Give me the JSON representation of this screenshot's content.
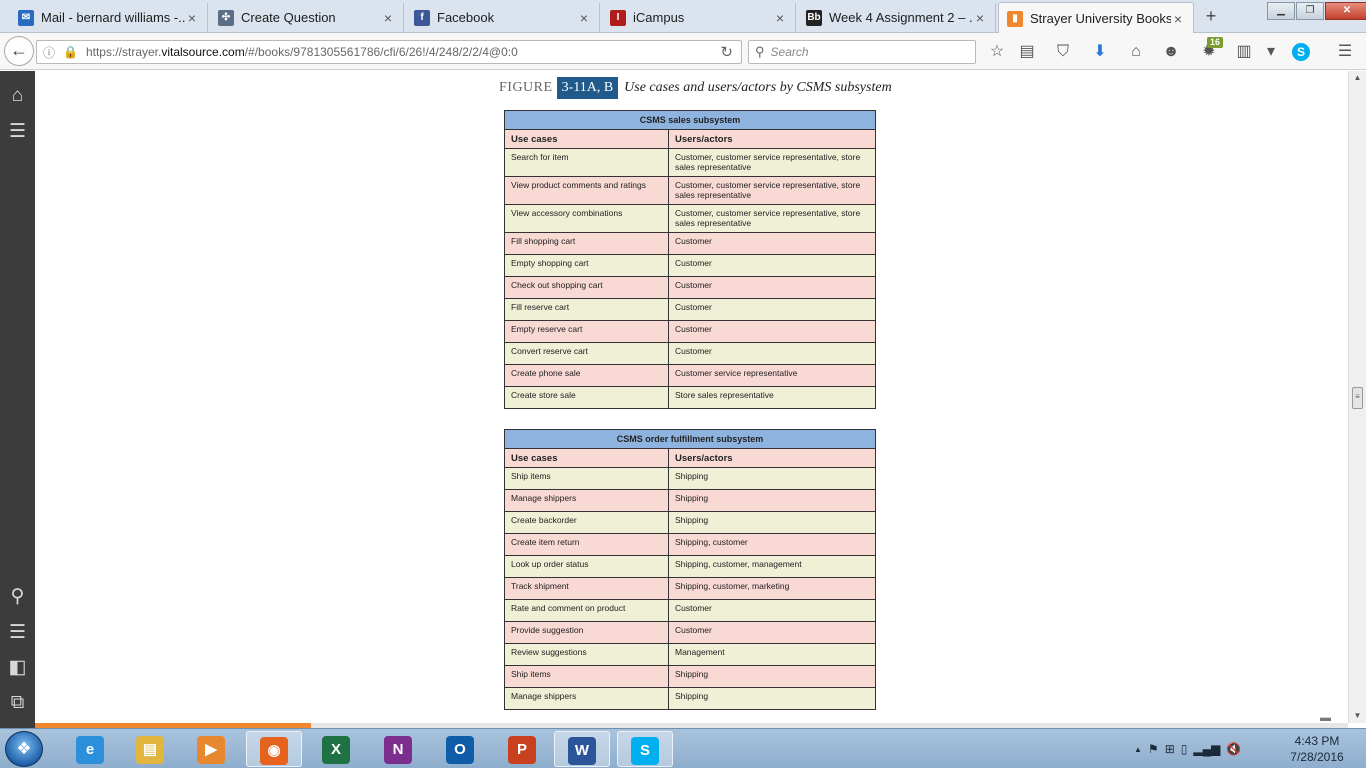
{
  "browser": {
    "tabs": [
      {
        "label": "Mail - bernard williams -...",
        "icon": "mail-icon",
        "icon_glyph": "✉",
        "icon_color": "#2a6ac0"
      },
      {
        "label": "Create Question",
        "icon": "network-icon",
        "icon_glyph": "✣",
        "icon_color": "#5a6f85"
      },
      {
        "label": "Facebook",
        "icon": "facebook-icon",
        "icon_glyph": "f",
        "icon_color": "#3b5998"
      },
      {
        "label": "iCampus",
        "icon": "icampus-icon",
        "icon_glyph": "I",
        "icon_color": "#b11d1d"
      },
      {
        "label": "Week 4 Assignment 2 – ...",
        "icon": "blackboard-icon",
        "icon_glyph": "Bb",
        "icon_color": "#222222"
      },
      {
        "label": "Strayer University Books...",
        "icon": "vitalsource-icon",
        "icon_glyph": "▮",
        "icon_color": "#f0862d"
      }
    ],
    "tab_close_glyph": "×",
    "new_tab_glyph": "+",
    "window_controls": {
      "minimize": "▁",
      "maximize": "❐",
      "close": "✕"
    },
    "url_prefix": "https://strayer.",
    "url_domain": "vitalsource.com",
    "url_path": "/#/books/9781305561786/cfi/6/26!/4/248/2/2/4@0:0",
    "search_placeholder": "Search",
    "extension_badge": "16",
    "back_glyph": "←",
    "info_glyph": "ⓘ",
    "lock_glyph": "🔒",
    "reload_glyph": "↻",
    "search_glyph": "⚲",
    "toolbar_icons": [
      {
        "name": "bookmark-star-icon",
        "glyph": "☆"
      },
      {
        "name": "reading-list-icon",
        "glyph": "▤"
      },
      {
        "name": "pocket-icon",
        "glyph": "⛉"
      },
      {
        "name": "downloads-icon",
        "glyph": "⬇"
      },
      {
        "name": "home-icon",
        "glyph": "⌂"
      },
      {
        "name": "chat-icon",
        "glyph": "☻"
      },
      {
        "name": "extension-icon",
        "glyph": "✹"
      },
      {
        "name": "clipboard-icon",
        "glyph": "▥"
      },
      {
        "name": "dropdown-icon",
        "glyph": "▾"
      },
      {
        "name": "skype-icon",
        "glyph": "S"
      },
      {
        "name": "menu-icon",
        "glyph": "☰"
      }
    ]
  },
  "sidebar": {
    "top_icons": [
      {
        "name": "home-icon",
        "glyph": "⌂"
      },
      {
        "name": "menu-icon",
        "glyph": "☰"
      }
    ],
    "bottom_icons": [
      {
        "name": "search-icon",
        "glyph": "⚲"
      },
      {
        "name": "toc-icon",
        "glyph": "☰"
      },
      {
        "name": "bookmark-panel-icon",
        "glyph": "◧"
      },
      {
        "name": "copy-icon",
        "glyph": "⧉"
      }
    ]
  },
  "figure": {
    "label": "FIGURE",
    "number": "3-11A, B",
    "title": "Use cases and users/actors by CSMS subsystem"
  },
  "tables": [
    {
      "title": "CSMS sales subsystem",
      "col1": "Use cases",
      "col2": "Users/actors",
      "rows": [
        {
          "use_case": "Search for item",
          "actors": "Customer, customer service representative, store sales representative"
        },
        {
          "use_case": "View product comments and ratings",
          "actors": "Customer, customer service representative, store sales representative"
        },
        {
          "use_case": "View accessory combinations",
          "actors": "Customer, customer service representative, store sales representative"
        },
        {
          "use_case": "Fill shopping cart",
          "actors": "Customer"
        },
        {
          "use_case": "Empty shopping cart",
          "actors": "Customer"
        },
        {
          "use_case": "Check out shopping cart",
          "actors": "Customer"
        },
        {
          "use_case": "Fill reserve cart",
          "actors": "Customer"
        },
        {
          "use_case": "Empty reserve cart",
          "actors": "Customer"
        },
        {
          "use_case": "Convert reserve cart",
          "actors": "Customer"
        },
        {
          "use_case": "Create phone sale",
          "actors": "Customer service representative"
        },
        {
          "use_case": "Create store sale",
          "actors": "Store sales representative"
        }
      ]
    },
    {
      "title": "CSMS order fulfillment subsystem",
      "col1": "Use cases",
      "col2": "Users/actors",
      "rows": [
        {
          "use_case": "Ship items",
          "actors": "Shipping"
        },
        {
          "use_case": "Manage shippers",
          "actors": "Shipping"
        },
        {
          "use_case": "Create backorder",
          "actors": "Shipping"
        },
        {
          "use_case": "Create item return",
          "actors": "Shipping, customer"
        },
        {
          "use_case": "Look up order status",
          "actors": "Shipping, customer, management"
        },
        {
          "use_case": "Track shipment",
          "actors": "Shipping, customer, marketing"
        },
        {
          "use_case": "Rate and comment on product",
          "actors": "Customer"
        },
        {
          "use_case": "Provide suggestion",
          "actors": "Customer"
        },
        {
          "use_case": "Review suggestions",
          "actors": "Management"
        },
        {
          "use_case": "Ship items",
          "actors": "Shipping"
        },
        {
          "use_case": "Manage shippers",
          "actors": "Shipping"
        }
      ]
    }
  ],
  "reading_progress": 0.21,
  "scrollbar": {
    "up": "▲",
    "down": "▼",
    "grip": "≡"
  },
  "page_menu_glyph": "▬",
  "taskbar": {
    "start_glyph": "❖",
    "apps": [
      {
        "name": "internet-explorer-icon",
        "glyph": "e",
        "color": "#2b8fdc",
        "open": false
      },
      {
        "name": "file-explorer-icon",
        "glyph": "▤",
        "color": "#e2b53f",
        "open": false
      },
      {
        "name": "media-player-icon",
        "glyph": "▶",
        "color": "#e8882e",
        "open": false
      },
      {
        "name": "firefox-icon",
        "glyph": "◉",
        "color": "#e5631f",
        "open": true
      },
      {
        "name": "excel-icon",
        "glyph": "X",
        "color": "#1f7244",
        "open": false
      },
      {
        "name": "onenote-icon",
        "glyph": "N",
        "color": "#7b2e8d",
        "open": false
      },
      {
        "name": "outlook-icon",
        "glyph": "O",
        "color": "#0f5da8",
        "open": false
      },
      {
        "name": "powerpoint-icon",
        "glyph": "P",
        "color": "#c9401f",
        "open": false
      },
      {
        "name": "word-icon",
        "glyph": "W",
        "color": "#2a5699",
        "open": true
      },
      {
        "name": "skype-icon",
        "glyph": "S",
        "color": "#00aff0",
        "open": true
      }
    ],
    "tray_icons": [
      {
        "name": "show-hidden-icons",
        "glyph": "▲"
      },
      {
        "name": "action-center-icon",
        "glyph": "⚑"
      },
      {
        "name": "windows-flag-icon",
        "glyph": "⊞"
      },
      {
        "name": "battery-icon",
        "glyph": "▯"
      },
      {
        "name": "network-signal-icon",
        "glyph": "▂▄▆"
      },
      {
        "name": "volume-muted-icon",
        "glyph": "🔇"
      }
    ],
    "time": "4:43 PM",
    "date": "7/28/2016"
  }
}
